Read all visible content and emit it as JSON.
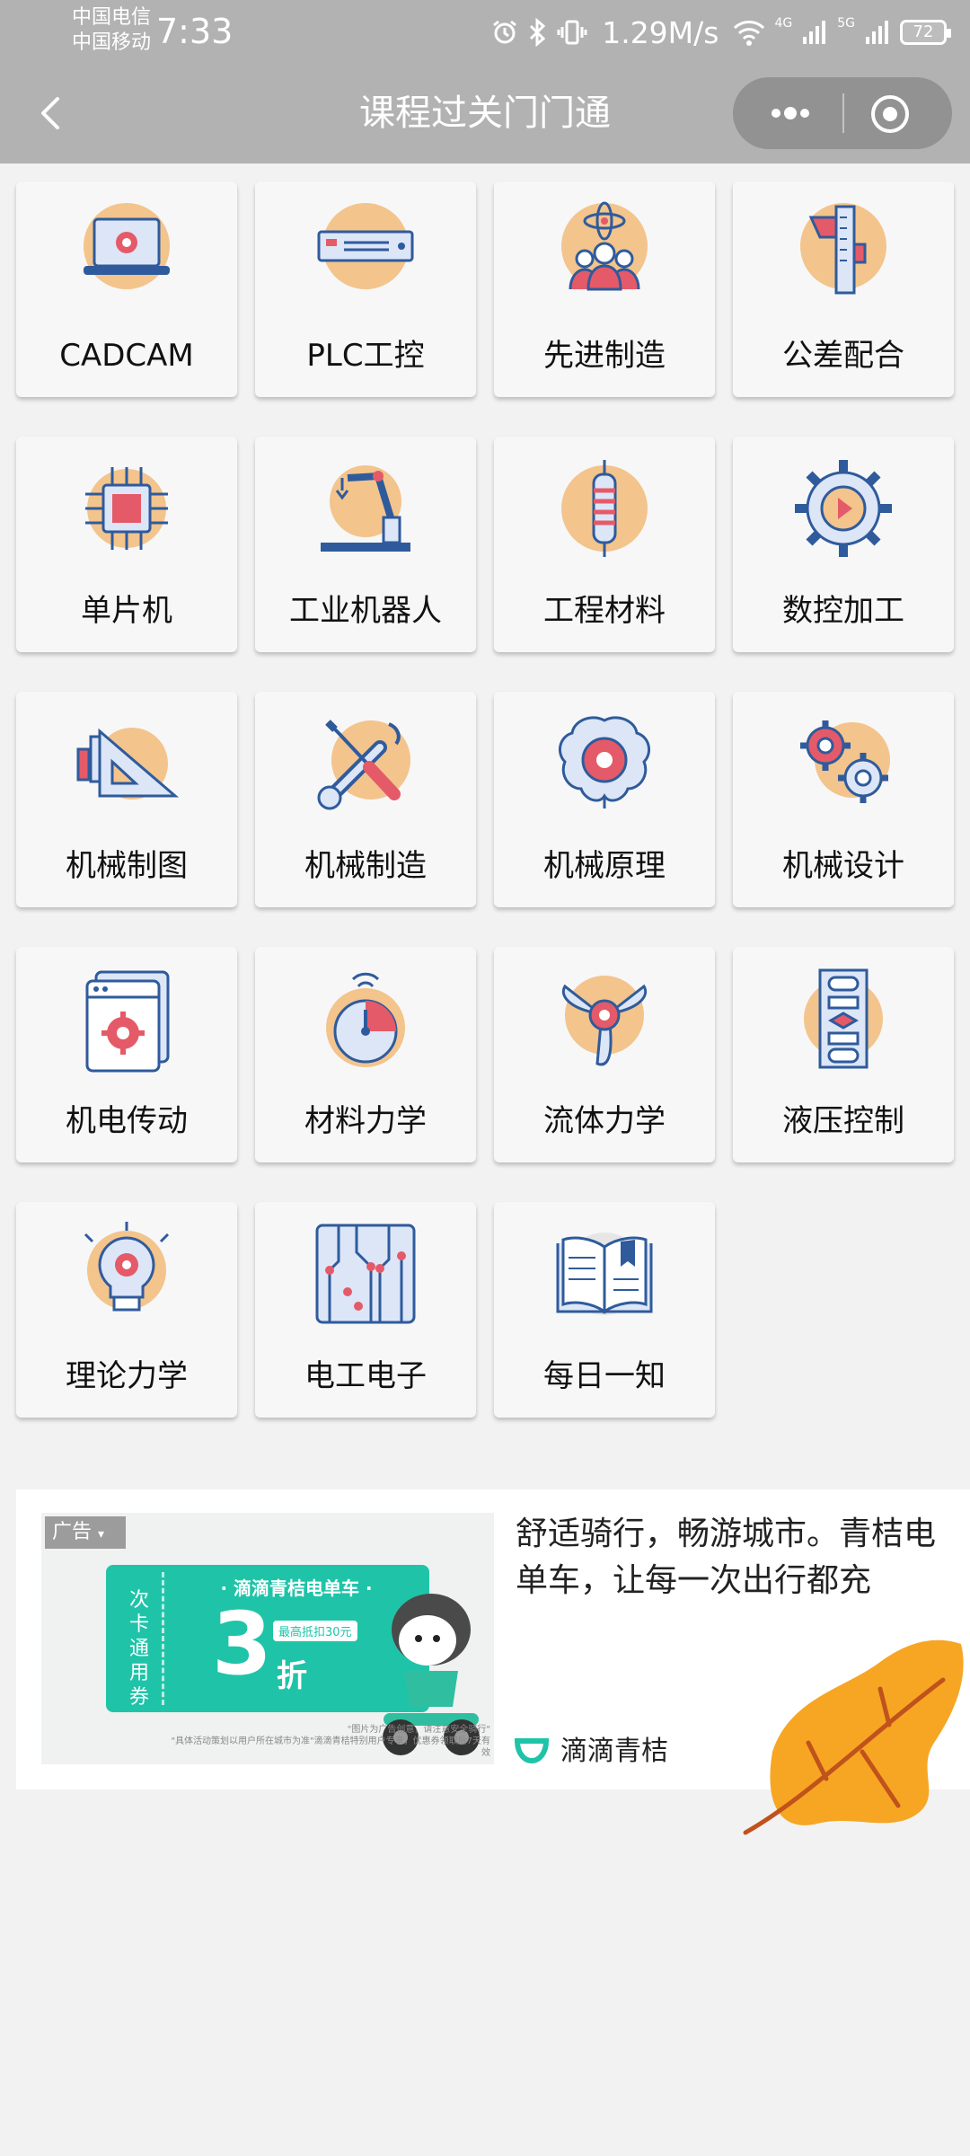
{
  "status_bar": {
    "carrier_top": "中国电信",
    "carrier_bottom": "中国移动",
    "time": "7:33",
    "speed": "1.29M/s",
    "net_4g": "4G",
    "net_5g": "5G",
    "battery": "72"
  },
  "nav": {
    "title": "课程过关门门通"
  },
  "courses": [
    {
      "label": "CADCAM",
      "icon": "laptop-gear-icon"
    },
    {
      "label": "PLC工控",
      "icon": "plc-device-icon"
    },
    {
      "label": "先进制造",
      "icon": "atom-team-icon"
    },
    {
      "label": "公差配合",
      "icon": "caliper-icon"
    },
    {
      "label": "单片机",
      "icon": "chip-icon"
    },
    {
      "label": "工业机器人",
      "icon": "robot-arm-icon"
    },
    {
      "label": "工程材料",
      "icon": "resistor-icon"
    },
    {
      "label": "数控加工",
      "icon": "gear-play-icon"
    },
    {
      "label": "机械制图",
      "icon": "drafting-tools-icon"
    },
    {
      "label": "机械制造",
      "icon": "wrench-screwdriver-icon"
    },
    {
      "label": "机械原理",
      "icon": "brain-gear-icon"
    },
    {
      "label": "机械设计",
      "icon": "gears-icon"
    },
    {
      "label": "机电传动",
      "icon": "window-gear-icon"
    },
    {
      "label": "材料力学",
      "icon": "gauge-icon"
    },
    {
      "label": "流体力学",
      "icon": "propeller-icon"
    },
    {
      "label": "液压控制",
      "icon": "flowchart-icon"
    },
    {
      "label": "理论力学",
      "icon": "lightbulb-gear-icon"
    },
    {
      "label": "电工电子",
      "icon": "circuit-board-icon"
    },
    {
      "label": "每日一知",
      "icon": "open-book-icon"
    }
  ],
  "ad": {
    "tag": "广告",
    "coupon_side": "次卡通用券",
    "coupon_brand": "· 滴滴青桔电单车 ·",
    "coupon_number": "3",
    "coupon_unit": "折",
    "coupon_badge": "最高抵扣30元",
    "fineprint_1": "\"图片为广告创意，请注意安全骑行\"",
    "fineprint_2": "\"具体活动策划以用户所在城市为准\"滴滴青桔特别用户专享，优惠券领取后7天有效",
    "text": "舒适骑行，畅游城市。青桔电单车，让每一次出行都充",
    "brand_name": "滴滴青桔",
    "brand_color": "#1fc4a8"
  },
  "colors": {
    "header_bg": "#b2b2b2",
    "page_bg": "#f2f2f2",
    "icon_circle": "#f3c48c",
    "icon_blue": "#2f5b9c",
    "icon_red": "#e55a68",
    "leaf": "#f6a623"
  }
}
